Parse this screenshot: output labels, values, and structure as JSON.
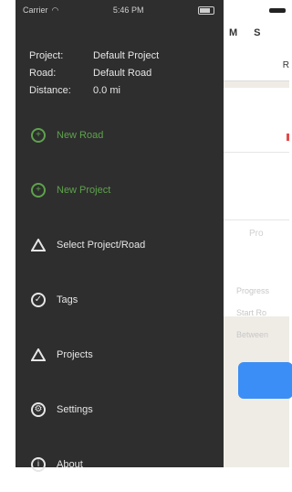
{
  "status_bar": {
    "carrier": "Carrier",
    "time": "5:46 PM"
  },
  "drawer": {
    "info": [
      {
        "label": "Project:",
        "value": "Default Project"
      },
      {
        "label": "Road:",
        "value": "Default Road"
      },
      {
        "label": "Distance:",
        "value": "0.0 mi"
      }
    ],
    "items": [
      {
        "label": "New Road",
        "icon": "plus-circle-icon",
        "color": "#5ea24c"
      },
      {
        "label": "New Project",
        "icon": "plus-circle-icon",
        "color": "#5ea24c"
      },
      {
        "label": "Select Project/Road",
        "icon": "triangle-icon",
        "color": "#e6e6e6"
      },
      {
        "label": "Tags",
        "icon": "tag-circle-icon",
        "color": "#e6e6e6"
      },
      {
        "label": "Projects",
        "icon": "triangle-icon",
        "color": "#e6e6e6"
      },
      {
        "label": "Settings",
        "icon": "gear-icon",
        "color": "#e6e6e6"
      },
      {
        "label": "About",
        "icon": "info-icon",
        "color": "#e6e6e6"
      }
    ]
  },
  "main": {
    "nav_icons": [
      "M",
      "S"
    ],
    "nav_subtitle": "R",
    "card_label": "Pro",
    "meta_lines": [
      "Progress",
      "Start Ro",
      "Between"
    ],
    "accent": "#3b8ef5"
  }
}
